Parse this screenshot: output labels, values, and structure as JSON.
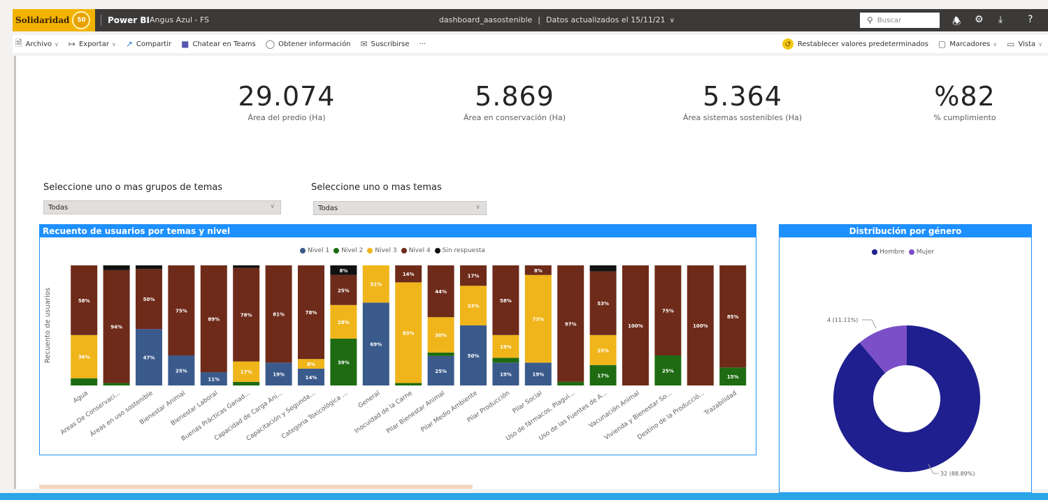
{
  "topbar": {
    "logo_text": "Solidaridad",
    "logo_badge": "50",
    "app_name": "Power BI",
    "workspace": "Angus Azul - FS",
    "report_name": "dashboard_aasostenible",
    "separator": "|",
    "updated_text": "Datos actualizados el 15/11/21",
    "search_placeholder": "Buscar",
    "help": "?"
  },
  "actions": {
    "left": [
      "Archivo",
      "Exportar",
      "Compartir",
      "Chatear en Teams",
      "Obtener información",
      "Suscribirse",
      "···"
    ],
    "reset": "Restablecer valores predeterminados",
    "bookmarks": "Marcadores",
    "view": "Vista"
  },
  "kpis": [
    {
      "value": "29.074",
      "label": "Área del predio (Ha)"
    },
    {
      "value": "5.869",
      "label": "Área en conservación (Ha)"
    },
    {
      "value": "5.364",
      "label": "Área sistemas sostenibles (Ha)"
    },
    {
      "value": "%82",
      "label": "% cumplimiento"
    }
  ],
  "slicers": [
    {
      "title": "Seleccione uno o mas grupos de temas",
      "value": "Todas"
    },
    {
      "title": "Seleccione uno o mas temas",
      "value": "Todas"
    }
  ],
  "colors": {
    "nivel1": "#3a5a8c",
    "nivel2": "#1e6b12",
    "nivel3": "#efb51a",
    "nivel4": "#6e2b1a",
    "sin": "#111111",
    "hombre": "#1f1f8f",
    "mujer": "#7b4fc8",
    "header": "#1e90ff"
  },
  "chart_data": [
    {
      "type": "bar",
      "stacked": "100%",
      "title": "Recuento de usuarios por temas y nivel",
      "ylabel": "Recuento de usuarios",
      "xlabel": "",
      "legend_position": "top-center",
      "categories": [
        "Agua",
        "Areas De Conservaci...",
        "Áreas en uso sostenible",
        "Bienestar Animal",
        "Bienestar Laboral",
        "Buenas Prácticas Ganad...",
        "Capacidad de Carga Ani...",
        "Capacitación y Segunda...",
        "Categoria Toxicológica ...",
        "General",
        "Inocuidad de la Carne",
        "Pilar Bienestar Animal",
        "Pilar Medio Ambiente",
        "Pilar Producción",
        "Pilar Social",
        "Uso de fármacos, Plagui...",
        "Uso de las Fuentes de A...",
        "Vacunación Animal",
        "Vivienda y Bienestar So...",
        "Destino de la Producció...",
        "Trazabilidad"
      ],
      "series": [
        {
          "name": "Nivel 1",
          "values": [
            0,
            0,
            47,
            25,
            11,
            0,
            19,
            14,
            0,
            69,
            0,
            25,
            50,
            19,
            19,
            0,
            0,
            0,
            0,
            0,
            0
          ],
          "labels": [
            "",
            "",
            "47%",
            "25%",
            "11%",
            "",
            "19%",
            "14%",
            "",
            "69%",
            "",
            "25%",
            "50%",
            "19%",
            "19%",
            "",
            "",
            "",
            "",
            "",
            ""
          ]
        },
        {
          "name": "Nivel 2",
          "values": [
            6,
            2,
            0,
            0,
            0,
            3,
            0,
            0,
            39,
            0,
            2,
            3,
            0,
            4,
            0,
            3,
            17,
            0,
            25,
            0,
            15
          ],
          "labels": [
            "",
            "",
            "",
            "",
            "",
            "",
            "",
            "",
            "39%",
            "",
            "",
            "",
            "",
            "",
            "",
            "",
            "17%",
            "",
            "25%",
            "",
            "15%"
          ]
        },
        {
          "name": "Nivel 3",
          "values": [
            36,
            0,
            0,
            0,
            0,
            17,
            0,
            8,
            28,
            31,
            83,
            30,
            33,
            19,
            73,
            0,
            25,
            0,
            0,
            0,
            0
          ],
          "labels": [
            "36%",
            "",
            "",
            "",
            "",
            "17%",
            "",
            "8%",
            "28%",
            "31%",
            "83%",
            "30%",
            "33%",
            "19%",
            "73%",
            "",
            "25%",
            "",
            "",
            "",
            ""
          ]
        },
        {
          "name": "Nivel 4",
          "values": [
            58,
            94,
            50,
            75,
            89,
            78,
            81,
            78,
            25,
            0,
            14,
            44,
            17,
            58,
            8,
            97,
            53,
            100,
            75,
            100,
            85
          ],
          "labels": [
            "58%",
            "94%",
            "50%",
            "75%",
            "89%",
            "78%",
            "81%",
            "78%",
            "25%",
            "",
            "14%",
            "44%",
            "17%",
            "58%",
            "8%",
            "97%",
            "53%",
            "100%",
            "75%",
            "100%",
            "85%"
          ]
        },
        {
          "name": "Sin respuesta",
          "values": [
            0,
            4,
            3,
            0,
            0,
            2,
            0,
            0,
            8,
            0,
            0,
            0,
            0,
            0,
            0,
            0,
            5,
            0,
            0,
            0,
            0
          ],
          "labels": [
            "",
            "",
            "",
            "",
            "",
            "",
            "",
            "",
            "8%",
            "",
            "",
            "",
            "",
            "",
            "",
            "",
            "",
            "",
            "",
            "",
            ""
          ]
        }
      ]
    },
    {
      "type": "pie",
      "donut": true,
      "title": "Distribución por género",
      "legend_position": "top-center",
      "slices": [
        {
          "name": "Hombre",
          "value": 32,
          "label": "32 (88.89%)"
        },
        {
          "name": "Mujer",
          "value": 4,
          "label": "4 (11.11%)"
        }
      ]
    }
  ]
}
